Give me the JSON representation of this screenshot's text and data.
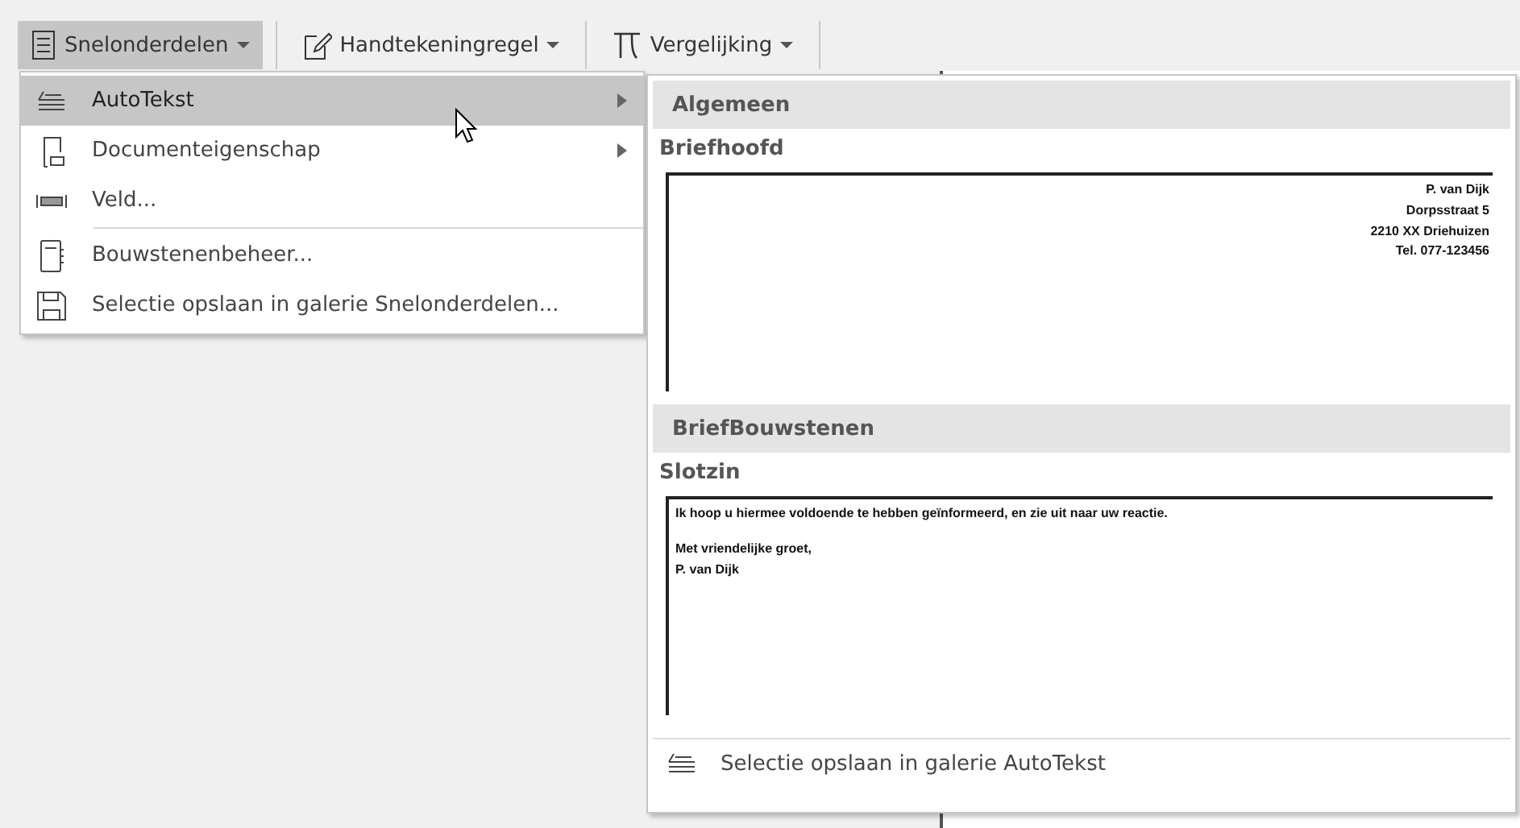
{
  "ribbon": {
    "buttons": [
      {
        "label": "Snelonderdelen",
        "kind": "parts",
        "pressed": true
      },
      {
        "label": "Handtekeningregel",
        "kind": "signature",
        "pressed": false
      },
      {
        "label": "Vergelijking",
        "kind": "equation",
        "pressed": false
      }
    ]
  },
  "menu": {
    "items": [
      {
        "label": "AutoTekst",
        "kind": "autotext",
        "submenu": true,
        "selected": true
      },
      {
        "label": "Documenteigenschap",
        "kind": "property",
        "submenu": true,
        "selected": false
      },
      {
        "label": "Veld...",
        "kind": "field",
        "submenu": false,
        "selected": false
      },
      {
        "label": "Bouwstenenbeheer...",
        "kind": "organizer",
        "submenu": false,
        "selected": false,
        "separator_before": true
      },
      {
        "label": "Selectie opslaan in galerie Snelonderdelen...",
        "kind": "save",
        "submenu": false,
        "selected": false
      }
    ]
  },
  "gallery": {
    "groups": [
      {
        "heading": "Algemeen",
        "entries": [
          {
            "name": "Briefhoofd",
            "kind": "letterhead",
            "paragraphs": [
              [
                "P. van Dijk",
                "Dorpsstraat 5",
                "2210 XX Driehuizen",
                "Tel. 077-123456"
              ]
            ]
          }
        ]
      },
      {
        "heading": "BriefBouwstenen",
        "entries": [
          {
            "name": "Slotzin",
            "kind": "closing",
            "paragraphs": [
              [
                "Ik hoop u hiermee voldoende te hebben geïnformeerd, en zie uit naar uw reactie."
              ],
              [
                "Met vriendelijke groet,",
                "P. van Dijk"
              ]
            ]
          }
        ]
      }
    ],
    "footer": {
      "label": "Selectie opslaan in galerie AutoTekst"
    }
  }
}
